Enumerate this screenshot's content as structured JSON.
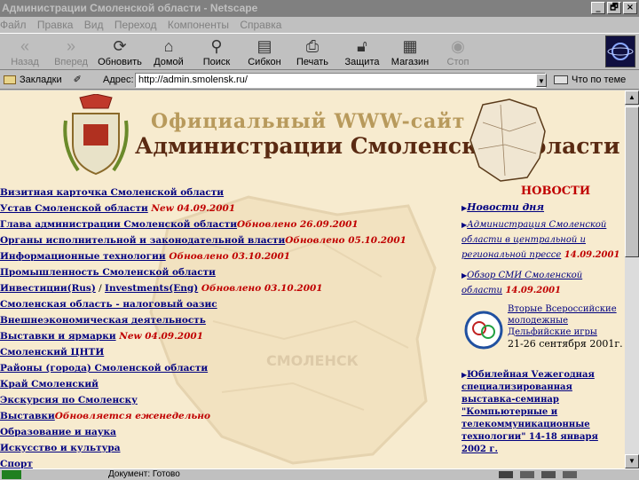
{
  "window": {
    "title": "Администрации Смоленской области - Netscape",
    "buttons": [
      "_",
      "🗗",
      "×"
    ]
  },
  "menu": [
    "Файл",
    "Правка",
    "Вид",
    "Переход",
    "Компоненты",
    "Справка"
  ],
  "toolbar": [
    {
      "label": "Назад",
      "icon": "back-icon",
      "disabled": true
    },
    {
      "label": "Вперед",
      "icon": "forward-icon",
      "disabled": true
    },
    {
      "label": "Обновить",
      "icon": "reload-icon",
      "disabled": false
    },
    {
      "label": "Домой",
      "icon": "home-icon",
      "disabled": false
    },
    {
      "label": "Поиск",
      "icon": "search-icon",
      "disabled": false
    },
    {
      "label": "Сибкон",
      "icon": "guide-icon",
      "disabled": false
    },
    {
      "label": "Печать",
      "icon": "print-icon",
      "disabled": false
    },
    {
      "label": "Защита",
      "icon": "security-icon",
      "disabled": false
    },
    {
      "label": "Магазин",
      "icon": "shop-icon",
      "disabled": false
    },
    {
      "label": "Стоп",
      "icon": "stop-icon",
      "disabled": true
    }
  ],
  "location": {
    "bookmarks_label": "Закладки",
    "address_label": "Адрес:",
    "url": "http://admin.smolensk.ru/",
    "related_label": "Что по теме"
  },
  "header": {
    "subtitle": "Официальный WWW-сайт",
    "title": "Администрации Смоленской области"
  },
  "links": [
    {
      "text": "Визитная карточка Смоленской области",
      "note": ""
    },
    {
      "text": "Устав Смоленской области",
      "note": " New 04.09.2001"
    },
    {
      "text": "Глава администрации Смоленской области",
      "note": "Обновлено 26.09.2001"
    },
    {
      "text": "Органы исполнительной и законодательной власти",
      "note": "Обновлено 05.10.2001"
    },
    {
      "text": "Информационные технологии",
      "note": " Обновлено 03.10.2001"
    },
    {
      "text": "Промышленность Смоленской области",
      "note": ""
    },
    {
      "text": "Инвестиции(Rus)",
      "sep": " / ",
      "text2": "Investments(Eng)",
      "note": " Обновлено 03.10.2001"
    },
    {
      "text": "Смоленская область - налоговый оазис",
      "note": ""
    },
    {
      "text": "Внешнеэкономическая деятельность",
      "note": ""
    },
    {
      "text": "Выставки и ярмарки",
      "note": "  New 04.09.2001"
    },
    {
      "text": "Смоленский ЦНТИ",
      "note": ""
    },
    {
      "text": "Районы (города) Смоленской области",
      "note": ""
    },
    {
      "text": "Край Смоленский",
      "note": ""
    },
    {
      "text": "Экскурсия по Смоленску",
      "note": ""
    },
    {
      "text": "Выставки",
      "note": "Обновляется еженедельно"
    },
    {
      "text": "Образование и наука",
      "note": ""
    },
    {
      "text": "Искусство и культура",
      "note": ""
    },
    {
      "text": "Спорт",
      "note": ""
    }
  ],
  "news": {
    "heading": "НОВОСТИ",
    "items": [
      {
        "title": "Новости дня",
        "date": ""
      },
      {
        "title": "Администрация Смоленской области в центральной и региональной прессе",
        "date": " 14.09.2001"
      },
      {
        "title": "Обзор СМИ Смоленской области",
        "date": "  14.09.2001"
      }
    ],
    "games": {
      "line1": "Вторые Всероссийские молодежные Дельфийские игры",
      "dates": "21-26 сентября 2001г."
    },
    "expo": "Юбилейная Vежегодная специализированная выставка-семинар \"Компьютерные и телекоммуникационные технологии\" 14-18 января 2002 г."
  },
  "map_label": "СМОЛЕНСК",
  "status": {
    "text": "Документ: Готово"
  }
}
